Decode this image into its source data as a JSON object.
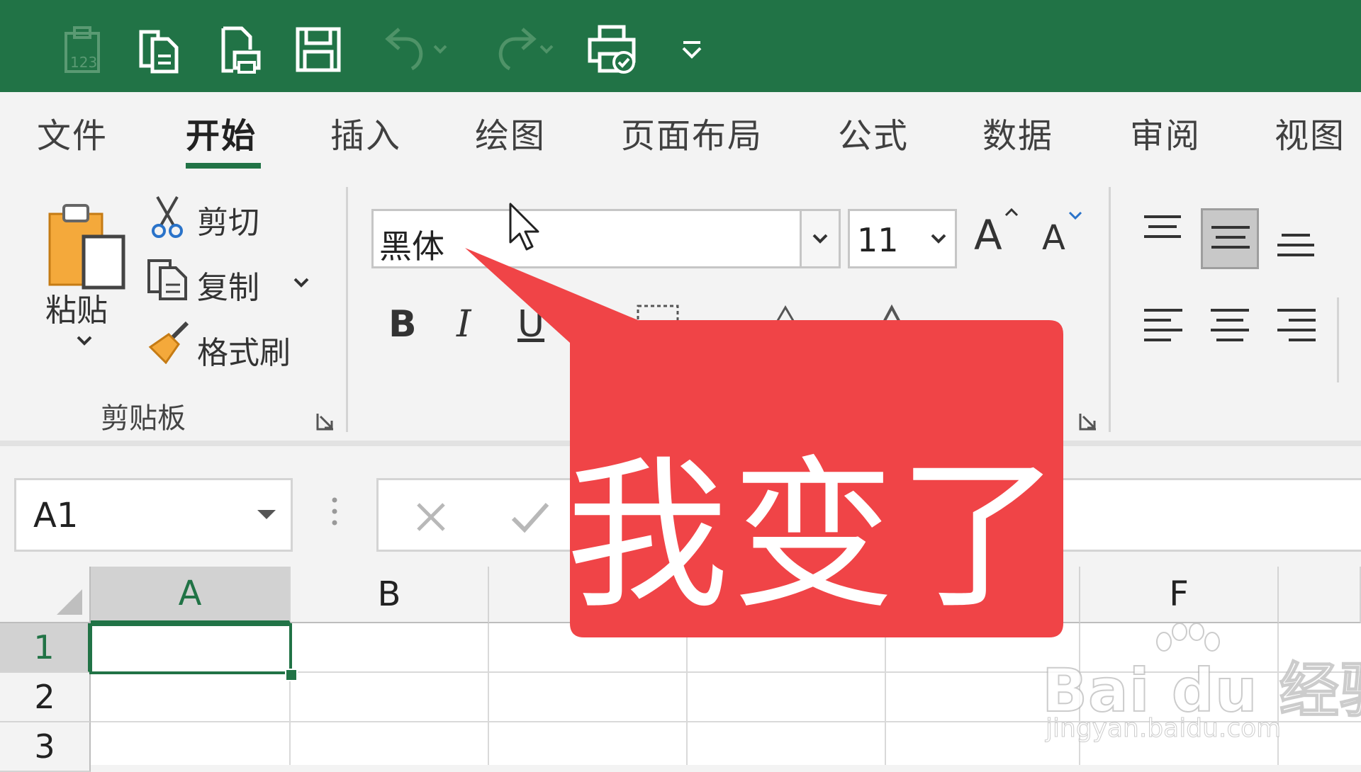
{
  "colors": {
    "title_bar": "#217346",
    "active_tab_underline": "#217346",
    "callout": "#f04447",
    "selection": "#217346"
  },
  "quick_access": {
    "icons": [
      "paste-values-icon",
      "copy-doc-icon",
      "print-preview-icon",
      "save-icon",
      "undo-icon",
      "redo-icon",
      "quick-print-icon",
      "customize-toolbar-icon"
    ]
  },
  "tabs": [
    {
      "label": "文件"
    },
    {
      "label": "开始"
    },
    {
      "label": "插入"
    },
    {
      "label": "绘图"
    },
    {
      "label": "页面布局"
    },
    {
      "label": "公式"
    },
    {
      "label": "数据"
    },
    {
      "label": "审阅"
    },
    {
      "label": "视图"
    }
  ],
  "clipboard": {
    "paste_label": "粘贴",
    "cut_label": "剪切",
    "copy_label": "复制",
    "format_painter_label": "格式刷",
    "group_label": "剪贴板"
  },
  "font": {
    "font_name": "黑体",
    "font_size": "11",
    "grow_label": "A",
    "shrink_label": "A",
    "bold_label": "B",
    "italic_label": "I",
    "underline_label": "U"
  },
  "name_box": {
    "value": "A1"
  },
  "grid": {
    "columns": [
      "A",
      "B",
      "F"
    ],
    "rows": [
      "1",
      "2",
      "3"
    ]
  },
  "callout": {
    "text": "我变了"
  },
  "watermark": {
    "main": "Bai du 经验",
    "sub": "jingyan.baidu.com"
  }
}
